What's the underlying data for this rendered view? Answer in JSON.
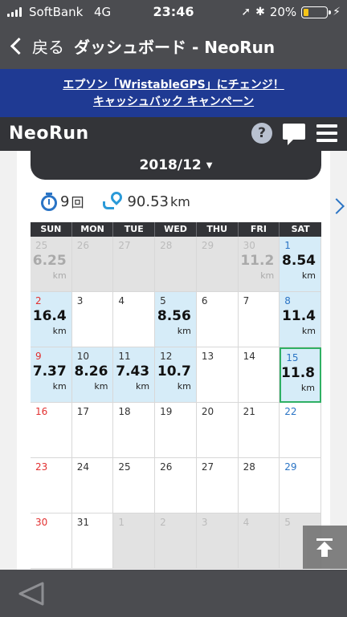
{
  "status": {
    "carrier": "SoftBank",
    "network": "4G",
    "time": "23:46",
    "battery": "20%",
    "battery_level": 0.2,
    "battery_color": "#f5c518"
  },
  "nav": {
    "back_label": "戻る",
    "title": "ダッシュボード - NeoRun"
  },
  "banner": {
    "line1": "エプソン「WristableGPS」にチェンジ！",
    "line2": "キャッシュバック キャンペーン"
  },
  "app": {
    "logo": "NeoRun",
    "help_glyph": "?"
  },
  "month": {
    "label": "2018/12",
    "caret": "▼"
  },
  "stats": {
    "count": "9",
    "count_unit": "回",
    "distance": "90.53",
    "distance_unit": "km"
  },
  "calendar": {
    "headers": [
      "SUN",
      "MON",
      "TUE",
      "WED",
      "THU",
      "FRI",
      "SAT"
    ],
    "unit": "km",
    "weeks": [
      [
        {
          "day": "25",
          "value": "6.25",
          "out": true
        },
        {
          "day": "26",
          "out": true
        },
        {
          "day": "27",
          "out": true
        },
        {
          "day": "28",
          "out": true
        },
        {
          "day": "29",
          "out": true
        },
        {
          "day": "30",
          "value": "11.2",
          "out": true
        },
        {
          "day": "1",
          "value": "8.54"
        }
      ],
      [
        {
          "day": "2",
          "value": "16.4"
        },
        {
          "day": "3"
        },
        {
          "day": "4"
        },
        {
          "day": "5",
          "value": "8.56"
        },
        {
          "day": "6"
        },
        {
          "day": "7"
        },
        {
          "day": "8",
          "value": "11.4"
        }
      ],
      [
        {
          "day": "9",
          "value": "7.37"
        },
        {
          "day": "10",
          "value": "8.26"
        },
        {
          "day": "11",
          "value": "7.43"
        },
        {
          "day": "12",
          "value": "10.7"
        },
        {
          "day": "13"
        },
        {
          "day": "14"
        },
        {
          "day": "15",
          "value": "11.8",
          "today": true
        }
      ],
      [
        {
          "day": "16"
        },
        {
          "day": "17"
        },
        {
          "day": "18"
        },
        {
          "day": "19"
        },
        {
          "day": "20"
        },
        {
          "day": "21"
        },
        {
          "day": "22"
        }
      ],
      [
        {
          "day": "23"
        },
        {
          "day": "24"
        },
        {
          "day": "25"
        },
        {
          "day": "26"
        },
        {
          "day": "27"
        },
        {
          "day": "28"
        },
        {
          "day": "29"
        }
      ],
      [
        {
          "day": "30"
        },
        {
          "day": "31"
        },
        {
          "day": "1",
          "out": true
        },
        {
          "day": "2",
          "out": true
        },
        {
          "day": "3",
          "out": true
        },
        {
          "day": "4",
          "out": true
        },
        {
          "day": "5",
          "out": true
        }
      ]
    ]
  },
  "colors": {
    "accent_blue": "#2a74c5",
    "sunday_red": "#e23030",
    "run_bg": "#d6ecf8",
    "today_border": "#2fb064",
    "banner_bg": "#1f3a93"
  }
}
